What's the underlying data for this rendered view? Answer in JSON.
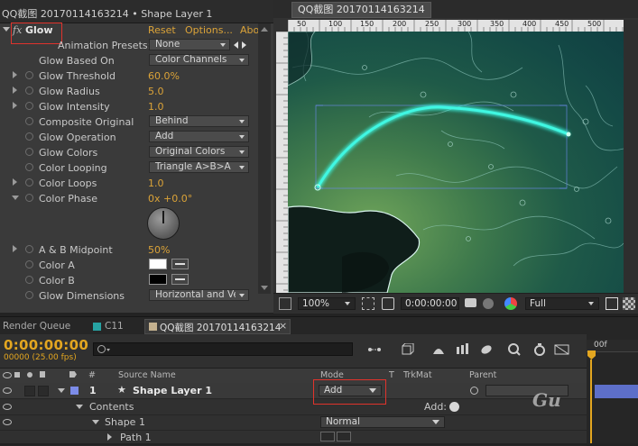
{
  "effect_controls": {
    "header_title": "QQ截图 20170114163214 • Shape Layer 1",
    "effect_name": "Glow",
    "reset_label": "Reset",
    "options_label": "Options...",
    "about_label": "Abo",
    "animation_presets_label": "Animation Presets:",
    "animation_presets_value": "None",
    "properties": {
      "glow_based_on": {
        "label": "Glow Based On",
        "value": "Color Channels"
      },
      "glow_threshold": {
        "label": "Glow Threshold",
        "value": "60.0%"
      },
      "glow_radius": {
        "label": "Glow Radius",
        "value": "5.0"
      },
      "glow_intensity": {
        "label": "Glow Intensity",
        "value": "1.0"
      },
      "composite_original": {
        "label": "Composite Original",
        "value": "Behind"
      },
      "glow_operation": {
        "label": "Glow Operation",
        "value": "Add"
      },
      "glow_colors": {
        "label": "Glow Colors",
        "value": "Original Colors"
      },
      "color_looping": {
        "label": "Color Looping",
        "value": "Triangle A>B>A"
      },
      "color_loops": {
        "label": "Color Loops",
        "value": "1.0"
      },
      "color_phase": {
        "label": "Color Phase",
        "value": "0x +0.0°"
      },
      "ab_midpoint": {
        "label": "A & B Midpoint",
        "value": "50%"
      },
      "color_a": {
        "label": "Color A",
        "color": "#ffffff"
      },
      "color_b": {
        "label": "Color B",
        "color": "#000000"
      },
      "glow_dimensions": {
        "label": "Glow Dimensions",
        "value": "Horizontal and Ve"
      }
    }
  },
  "composition": {
    "tab_label": "QQ截图 20170114163214",
    "ruler_ticks": [
      "50",
      "100",
      "150",
      "200",
      "250",
      "300",
      "350",
      "400",
      "450",
      "500"
    ],
    "zoom": "100%",
    "timecode": "0:00:00:00",
    "resolution": "Full"
  },
  "timeline": {
    "tabs": {
      "render_queue": "Render Queue",
      "c11": "C11",
      "active": "QQ截图 20170114163214"
    },
    "current_time": "0:00:00:00",
    "fps": "00000 (25.00 fps)",
    "search_placeholder": "",
    "columns": {
      "hash": "#",
      "source_name": "Source Name",
      "mode": "Mode",
      "t": "T",
      "trkmat": "TrkMat",
      "parent": "Parent"
    },
    "layers": [
      {
        "number": "1",
        "name": "Shape Layer 1",
        "mode": "Add"
      }
    ],
    "contents_label": "Contents",
    "add_label": "Add:",
    "shape_label": "Shape 1",
    "shape_mode": "Normal",
    "path_label": "Path 1",
    "time_ruler_label": "00f",
    "watermark": "Gu"
  },
  "colors": {
    "accent_orange": "#e3a620",
    "highlight_red": "#e0332c",
    "glow_cyan": "#3ff7e2"
  }
}
